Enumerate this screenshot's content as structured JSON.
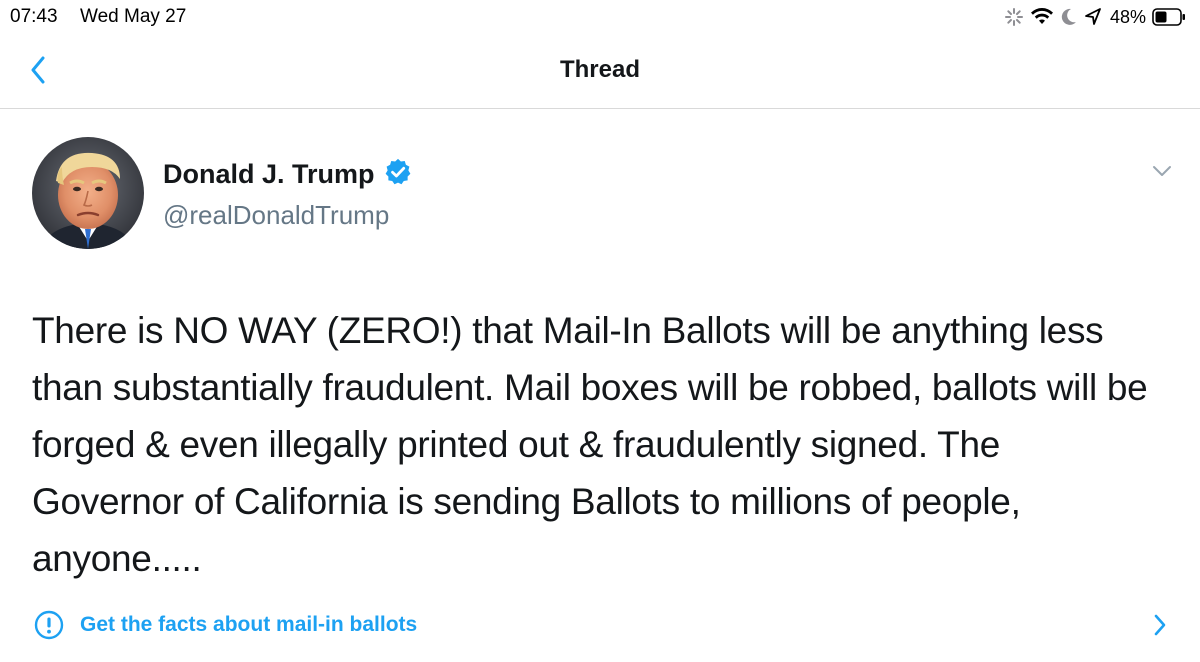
{
  "status_bar": {
    "time": "07:43",
    "date": "Wed May 27",
    "battery_percent": "48%",
    "battery_level": 0.48,
    "icons": [
      "activity-icon",
      "wifi-icon",
      "do-not-disturb-icon",
      "location-icon",
      "battery-icon"
    ]
  },
  "nav": {
    "title": "Thread",
    "back_icon": "chevron-left-icon"
  },
  "tweet": {
    "author_name": "Donald J. Trump",
    "verified": true,
    "handle": "@realDonaldTrump",
    "text": "There is NO WAY (ZERO!) that Mail-In Ballots will be anything less than substantially fraudulent. Mail boxes will be robbed, ballots will be forged & even illegally printed out & fraudulently signed. The Governor of California is sending Ballots to millions of people, anyone.....",
    "fact_check_label": "Get the facts about mail-in ballots"
  },
  "colors": {
    "accent": "#1da1f2",
    "text_primary": "#14171a",
    "text_secondary": "#657786",
    "divider": "#d9d9d9"
  }
}
